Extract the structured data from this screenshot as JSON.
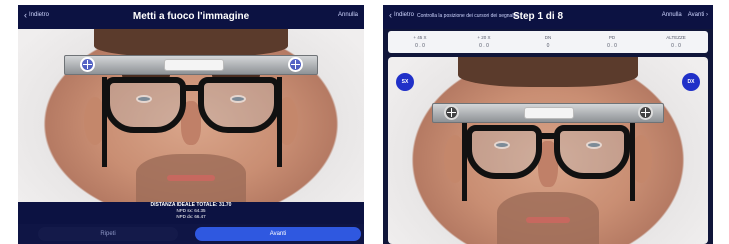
{
  "left": {
    "back_label": "Indietro",
    "title": "Metti a fuoco l'immagine",
    "cancel_label": "Annulla",
    "measurements": [
      "DISTANZA IDEALE TOTALE: 31.70",
      "NPD sx: 64.35",
      "NPD dx: 66.47"
    ],
    "repeat_button": "Ripeti",
    "next_button": "Avanti"
  },
  "right": {
    "back_label": "Indietro",
    "subtitle": "Controlla la posizione dei cursori dei segnalini",
    "title": "Step 1 di 8",
    "cancel_label": "Annulla",
    "next_label": "Avanti",
    "measures": [
      {
        "label": "+ 45 X",
        "value": "0 . 0"
      },
      {
        "label": "+ 20 X",
        "value": "0 . 0"
      },
      {
        "label": "DN",
        "value": "0"
      },
      {
        "label": "PD",
        "value": "0 . 0"
      },
      {
        "label": "ALTEZZE",
        "value": "0 . 0"
      }
    ],
    "badge_left": "SX",
    "badge_right": "DX"
  },
  "colors": {
    "nav_bg": "#0c1242",
    "accent": "#2f58e0",
    "badge": "#2030c8"
  }
}
